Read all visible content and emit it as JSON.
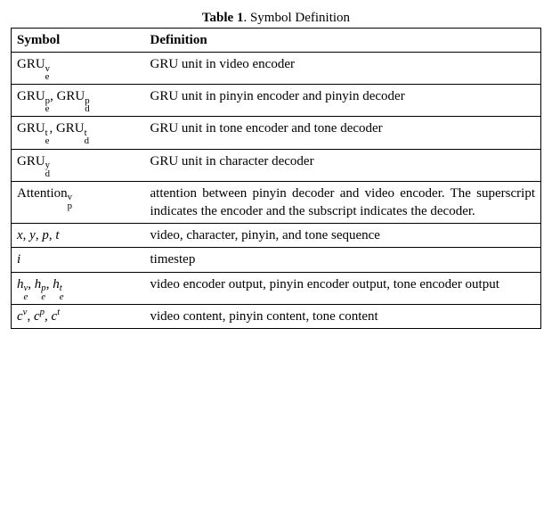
{
  "caption": {
    "label": "Table 1",
    "title": "Symbol Definition"
  },
  "header": {
    "c1": "Symbol",
    "c2": "Definition"
  },
  "rows": {
    "r1": {
      "def": "GRU unit in video encoder"
    },
    "r2": {
      "def": "GRU unit in pinyin encoder and pinyin decoder"
    },
    "r3": {
      "def": "GRU unit in tone encoder and tone decoder"
    },
    "r4": {
      "def": "GRU unit in character decoder"
    },
    "r5": {
      "def": "attention between pinyin decoder and video encoder. The superscript indicates the encoder and the subscript indicates the decoder."
    },
    "r6": {
      "def": "video, character, pinyin, and tone sequence"
    },
    "r7": {
      "def": "timestep"
    },
    "r8": {
      "def": "video encoder output, pinyin encoder output, tone encoder output"
    },
    "r9": {
      "def": "video content, pinyin content, tone content"
    }
  },
  "chart_data": {
    "type": "table",
    "title": "Table 1. Symbol Definition",
    "columns": [
      "Symbol",
      "Definition"
    ],
    "rows": [
      {
        "Symbol": "GRU_e^v",
        "Definition": "GRU unit in video encoder"
      },
      {
        "Symbol": "GRU_e^p, GRU_d^p",
        "Definition": "GRU unit in pinyin encoder and pinyin decoder"
      },
      {
        "Symbol": "GRU_e^t, GRU_d^t",
        "Definition": "GRU unit in tone encoder and tone decoder"
      },
      {
        "Symbol": "GRU_d^y",
        "Definition": "GRU unit in character decoder"
      },
      {
        "Symbol": "Attention_p^v",
        "Definition": "attention between pinyin decoder and video encoder. The superscript indicates the encoder and the subscript indicates the decoder."
      },
      {
        "Symbol": "x, y, p, t",
        "Definition": "video, character, pinyin, and tone sequence"
      },
      {
        "Symbol": "i",
        "Definition": "timestep"
      },
      {
        "Symbol": "h_e^v, h_e^p, h_e^t",
        "Definition": "video encoder output, pinyin encoder output, tone encoder output"
      },
      {
        "Symbol": "c^v, c^p, c^t",
        "Definition": "video content, pinyin content, tone content"
      }
    ]
  }
}
